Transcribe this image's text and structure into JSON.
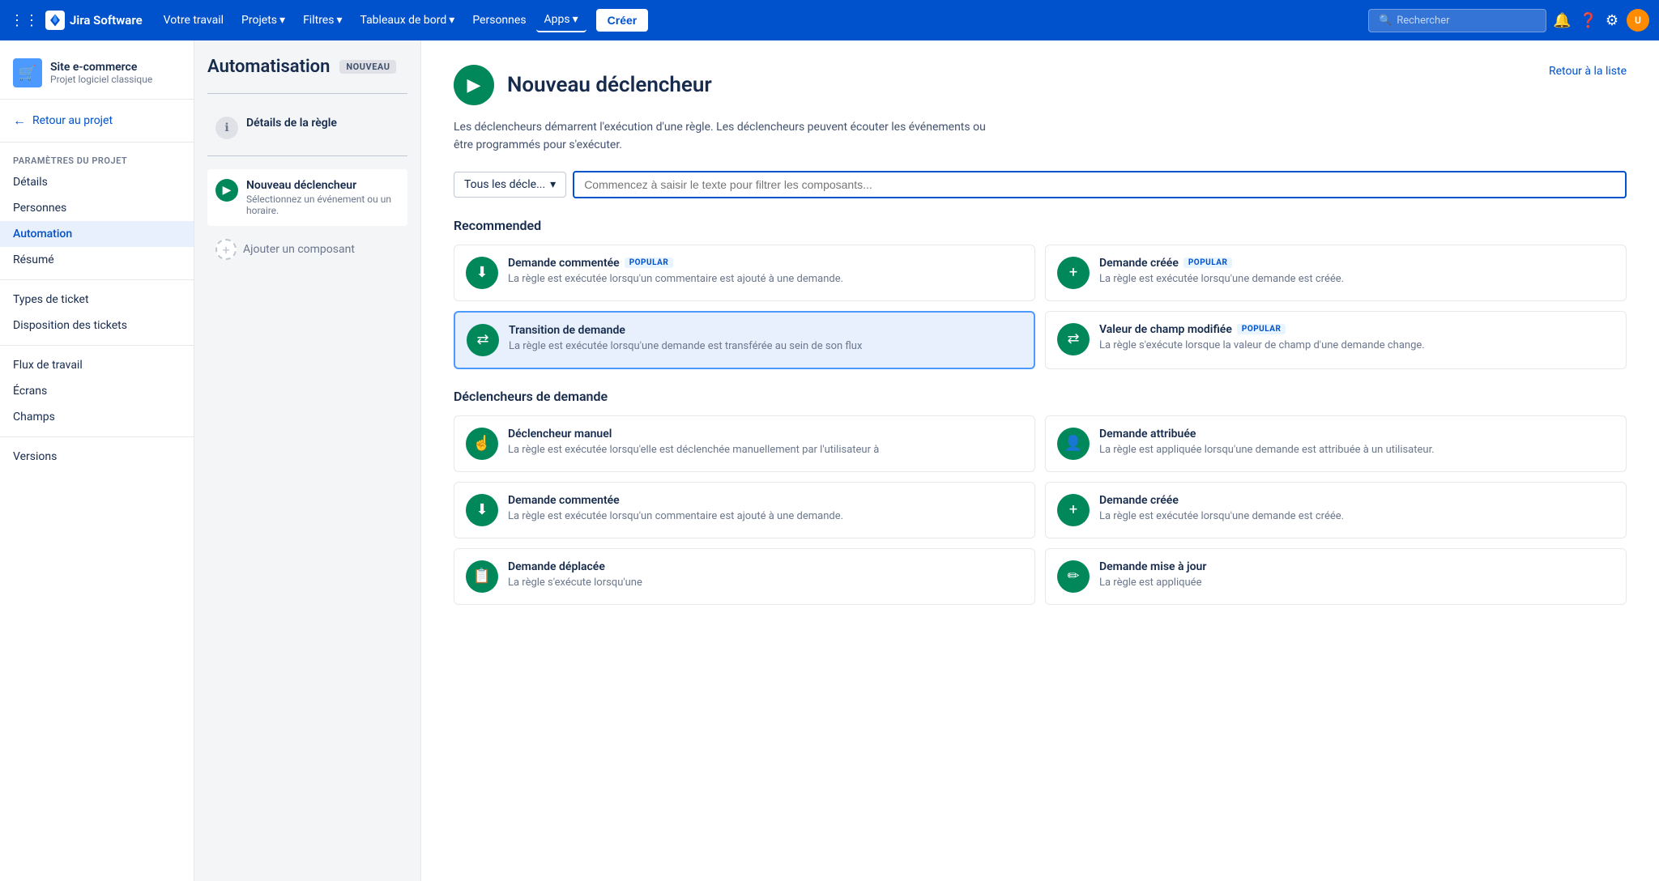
{
  "topnav": {
    "logo_text": "Jira Software",
    "nav_items": [
      {
        "label": "Votre travail",
        "has_arrow": false
      },
      {
        "label": "Projets",
        "has_arrow": true
      },
      {
        "label": "Filtres",
        "has_arrow": true
      },
      {
        "label": "Tableaux de bord",
        "has_arrow": true
      },
      {
        "label": "Personnes",
        "has_arrow": false
      },
      {
        "label": "Apps",
        "has_arrow": true
      }
    ],
    "create_label": "Créer",
    "search_placeholder": "Rechercher",
    "avatar_initials": "U"
  },
  "sidebar": {
    "project_name": "Site e-commerce",
    "project_sub": "Projet logiciel classique",
    "back_label": "Retour au projet",
    "section_label": "Paramètres du projet",
    "items": [
      {
        "label": "Détails",
        "active": false
      },
      {
        "label": "Personnes",
        "active": false
      },
      {
        "label": "Automation",
        "active": true
      },
      {
        "label": "Résumé",
        "active": false
      },
      {
        "label": "Types de ticket",
        "active": false
      },
      {
        "label": "Disposition des tickets",
        "active": false
      },
      {
        "label": "Flux de travail",
        "active": false
      },
      {
        "label": "Écrans",
        "active": false
      },
      {
        "label": "Champs",
        "active": false
      },
      {
        "label": "Versions",
        "active": false
      }
    ]
  },
  "middle": {
    "title": "Automatisation",
    "badge": "NOUVEAU",
    "steps": [
      {
        "label": "Détails de la règle",
        "type": "info",
        "icon": "ℹ"
      },
      {
        "title": "Nouveau déclencheur",
        "sub": "Sélectionnez un événement ou un horaire.",
        "type": "green",
        "icon": "▶"
      },
      {
        "label": "Ajouter un composant",
        "type": "add"
      }
    ]
  },
  "main": {
    "back_label": "Retour à la liste",
    "title": "Nouveau déclencheur",
    "play_icon": "▶",
    "description": "Les déclencheurs démarrent l'exécution d'une règle. Les déclencheurs peuvent écouter les événements ou être programmés pour s'exécuter.",
    "filter_dropdown_label": "Tous les décle...",
    "filter_placeholder": "Commencez à saisir le texte pour filtrer les composants...",
    "sections": [
      {
        "title": "Recommended",
        "cards": [
          {
            "title": "Demande commentée",
            "desc": "La règle est exécutée lorsqu'un commentaire est ajouté à une demande.",
            "badge": "POPULAR",
            "icon": "⬇",
            "highlighted": false
          },
          {
            "title": "Demande créée",
            "desc": "La règle est exécutée lorsqu'une demande est créée.",
            "badge": "POPULAR",
            "icon": "+",
            "highlighted": false
          },
          {
            "title": "Transition de demande",
            "desc": "La règle est exécutée lorsqu'une demande est transférée au sein de son flux",
            "badge": "",
            "icon": "⇄",
            "highlighted": true
          },
          {
            "title": "Valeur de champ modifiée",
            "desc": "La règle s'exécute lorsque la valeur de champ d'une demande change.",
            "badge": "POPULAR",
            "icon": "⇄",
            "highlighted": false
          }
        ]
      },
      {
        "title": "Déclencheurs de demande",
        "cards": [
          {
            "title": "Déclencheur manuel",
            "desc": "La règle est exécutée lorsqu'elle est déclenchée manuellement par l'utilisateur à",
            "badge": "",
            "icon": "☝",
            "highlighted": false
          },
          {
            "title": "Demande attribuée",
            "desc": "La règle est appliquée lorsqu'une demande est attribuée à un utilisateur.",
            "badge": "",
            "icon": "👤",
            "highlighted": false
          },
          {
            "title": "Demande commentée",
            "desc": "La règle est exécutée lorsqu'un commentaire est ajouté à une demande.",
            "badge": "",
            "icon": "⬇",
            "highlighted": false
          },
          {
            "title": "Demande créée",
            "desc": "La règle est exécutée lorsqu'une demande est créée.",
            "badge": "",
            "icon": "+",
            "highlighted": false
          },
          {
            "title": "Demande déplacée",
            "desc": "La règle s'exécute lorsqu'une",
            "badge": "",
            "icon": "📋",
            "highlighted": false
          },
          {
            "title": "Demande mise à jour",
            "desc": "La règle est appliquée",
            "badge": "",
            "icon": "✏",
            "highlighted": false
          }
        ]
      }
    ]
  }
}
